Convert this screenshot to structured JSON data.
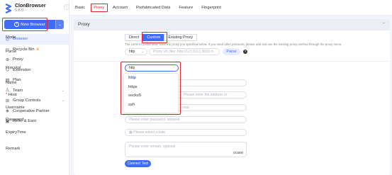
{
  "app": {
    "name": "ClonBrowser",
    "version": "5.8.0"
  },
  "sidebar": {
    "new_button": "New Browser",
    "items": [
      {
        "label": "Browser",
        "icon": "browser-icon"
      },
      {
        "label": "Recycle Bin",
        "icon": "trash-icon"
      },
      {
        "label": "Proxy",
        "icon": "proxy-icon"
      },
      {
        "label": "Extension",
        "icon": "extension-icon"
      },
      {
        "label": "Plan",
        "icon": "plan-icon"
      },
      {
        "label": "Team",
        "icon": "team-icon"
      },
      {
        "label": "Group Controls",
        "icon": "group-icon"
      },
      {
        "label": "Cooperative Partner",
        "icon": "partner-icon"
      },
      {
        "label": "Refer & Earn",
        "icon": "refer-icon"
      }
    ]
  },
  "tabs": [
    "Basic",
    "Proxy",
    "Account",
    "Prefabricated Data",
    "Feature",
    "Fingerprint"
  ],
  "panel": {
    "title": "Proxy",
    "mode_label": "Mode",
    "modes": [
      "Direct",
      "Custom",
      "Existing Proxy"
    ],
    "hint": "The current ClonBrowser uses the proxy you specified below. If you need other protocols, please add and use the existing proxy method through the proxy menu.",
    "parse_label": "Parse",
    "parse_select": "http",
    "parse_placeholder": "Proxy Url (like: http://127.0.0.1:3000 or",
    "parse_button": "Parse",
    "help_glyph": "?",
    "protocol_label": "Procotol",
    "protocol_value": "http",
    "protocol_options": [
      "http",
      "https",
      "socks5",
      "ssh"
    ],
    "name_label": "Name",
    "host_label": "Host",
    "host_placeholder": "Please enter the address (e",
    "username_label": "Username",
    "username_placeholder": "onal",
    "password_label": "Password",
    "password_placeholder": "Please enter password, optional",
    "expiry_label": "ExpiryTime",
    "expiry_placeholder": "Please select a date",
    "remark_label": "Remark",
    "remark_placeholder": "Please enter remark, optional",
    "remark_counter": "0/1500",
    "test_button": "Connect Test"
  },
  "colors": {
    "primary": "#3f6cf5",
    "highlight": "#e0232e",
    "crown": "#f5a623"
  }
}
